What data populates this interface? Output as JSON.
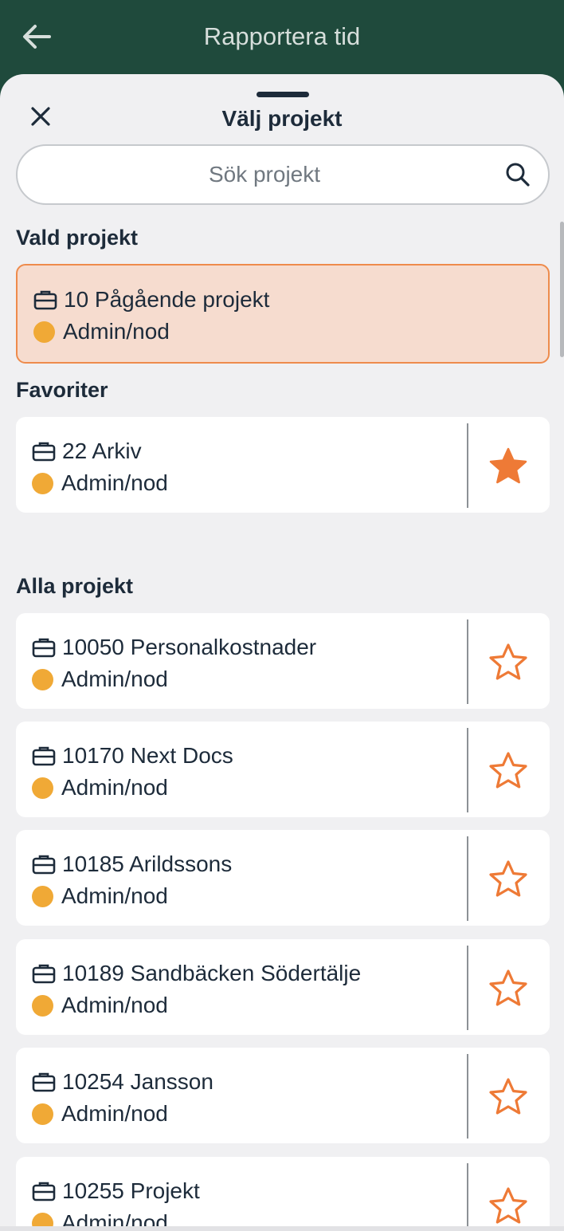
{
  "appbar": {
    "title": "Rapportera tid",
    "back_icon": "arrow-left-icon"
  },
  "sheet": {
    "title": "Välj projekt",
    "close_icon": "close-icon",
    "search": {
      "placeholder": "Sök projekt",
      "value": "",
      "icon": "search-icon"
    }
  },
  "sections": {
    "selected": "Vald projekt",
    "favorites": "Favoriter",
    "all": "Alla projekt"
  },
  "selected_project": {
    "name": "10 Pågående projekt",
    "category": "Admin/nod"
  },
  "favorites": [
    {
      "name": "22 Arkiv",
      "category": "Admin/nod",
      "favorite": true
    }
  ],
  "projects": [
    {
      "name": "10050 Personalkostnader",
      "category": "Admin/nod",
      "favorite": false
    },
    {
      "name": "10170 Next Docs",
      "category": "Admin/nod",
      "favorite": false
    },
    {
      "name": "10185 Arildssons",
      "category": "Admin/nod",
      "favorite": false
    },
    {
      "name": "10189 Sandbäcken Södertälje",
      "category": "Admin/nod",
      "favorite": false
    },
    {
      "name": "10254 Jansson",
      "category": "Admin/nod",
      "favorite": false
    },
    {
      "name": "10255 Projekt",
      "category": "Admin/nod",
      "favorite": false
    }
  ],
  "colors": {
    "appbar": "#1f4a3c",
    "accent": "#ee7a36",
    "status_dot": "#f0a936",
    "selected_bg": "#f6dccf"
  }
}
